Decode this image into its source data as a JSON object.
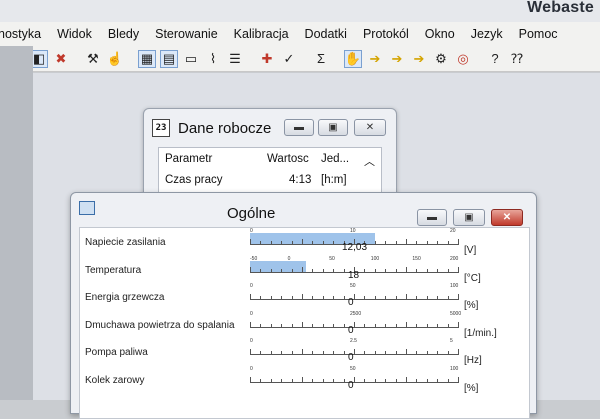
{
  "app_title": "Webaste",
  "menu": [
    "nostyka",
    "Widok",
    "Bledy",
    "Sterowanie",
    "Kalibracja",
    "Dodatki",
    "Protokól",
    "Okno",
    "Jezyk",
    "Pomoc"
  ],
  "toolbar": {
    "buttons": [
      {
        "name": "connect-icon",
        "glyph": "◧",
        "pressed": true
      },
      {
        "name": "disconnect-icon",
        "glyph": "✖",
        "pressed": false
      },
      {
        "name": "tools-icon",
        "glyph": "⚒",
        "pressed": false
      },
      {
        "name": "hand-tool-icon",
        "glyph": "☝",
        "pressed": false
      },
      {
        "name": "data-table-icon",
        "glyph": "▦",
        "pressed": true
      },
      {
        "name": "data-grid-icon",
        "glyph": "▤",
        "pressed": true
      },
      {
        "name": "monitor-icon",
        "glyph": "▭",
        "pressed": false
      },
      {
        "name": "chart-icon",
        "glyph": "⌇",
        "pressed": false
      },
      {
        "name": "list-icon",
        "glyph": "☰",
        "pressed": false
      },
      {
        "name": "error-icon",
        "glyph": "✚",
        "pressed": false
      },
      {
        "name": "check-icon",
        "glyph": "✓",
        "pressed": false
      },
      {
        "name": "sum-icon",
        "glyph": "Σ",
        "pressed": false
      },
      {
        "name": "hand-stop-icon",
        "glyph": "✋",
        "pressed": true
      },
      {
        "name": "arrow-right-icon",
        "glyph": "➔",
        "pressed": false
      },
      {
        "name": "arrow-warning-icon",
        "glyph": "➔",
        "pressed": false
      },
      {
        "name": "arrow-warning2-icon",
        "glyph": "➔",
        "pressed": false
      },
      {
        "name": "pump-icon",
        "glyph": "⚙",
        "pressed": false
      },
      {
        "name": "co2-icon",
        "glyph": "◎",
        "pressed": false
      },
      {
        "name": "help-icon",
        "glyph": "?",
        "pressed": false
      },
      {
        "name": "context-help-icon",
        "glyph": "⁇",
        "pressed": false
      }
    ]
  },
  "dane_robocze": {
    "title": "Dane robocze",
    "icon_text": "23",
    "columns": [
      "Parametr",
      "Wartosc",
      "Jed..."
    ],
    "rows": [
      [
        "Czas pracy",
        "4:13",
        "[h:m]"
      ]
    ]
  },
  "ogolne": {
    "title": "Ogólne",
    "params": [
      {
        "label": "Napiecie zasilania",
        "value": "12,03",
        "unit": "[V]",
        "fraction": 0.6,
        "ticks": [
          "0",
          "10",
          "20"
        ]
      },
      {
        "label": "Temperatura",
        "value": "18",
        "unit": "[°C]",
        "fraction": 0.27,
        "ticks": [
          "-50",
          "0",
          "50",
          "100",
          "150",
          "200"
        ]
      },
      {
        "label": "Energia grzewcza",
        "value": "0",
        "unit": "[%]",
        "fraction": 0,
        "ticks": [
          "0",
          "50",
          "100"
        ]
      },
      {
        "label": "Dmuchawa powietrza do spalania",
        "value": "0",
        "unit": "[1/min.]",
        "fraction": 0,
        "ticks": [
          "0",
          "2500",
          "5000"
        ]
      },
      {
        "label": "Pompa paliwa",
        "value": "0",
        "unit": "[Hz]",
        "fraction": 0,
        "ticks": [
          "0",
          "2.5",
          "5"
        ]
      },
      {
        "label": "Kolek zarowy",
        "value": "0",
        "unit": "[%]",
        "fraction": 0,
        "ticks": [
          "0",
          "50",
          "100"
        ]
      }
    ]
  }
}
